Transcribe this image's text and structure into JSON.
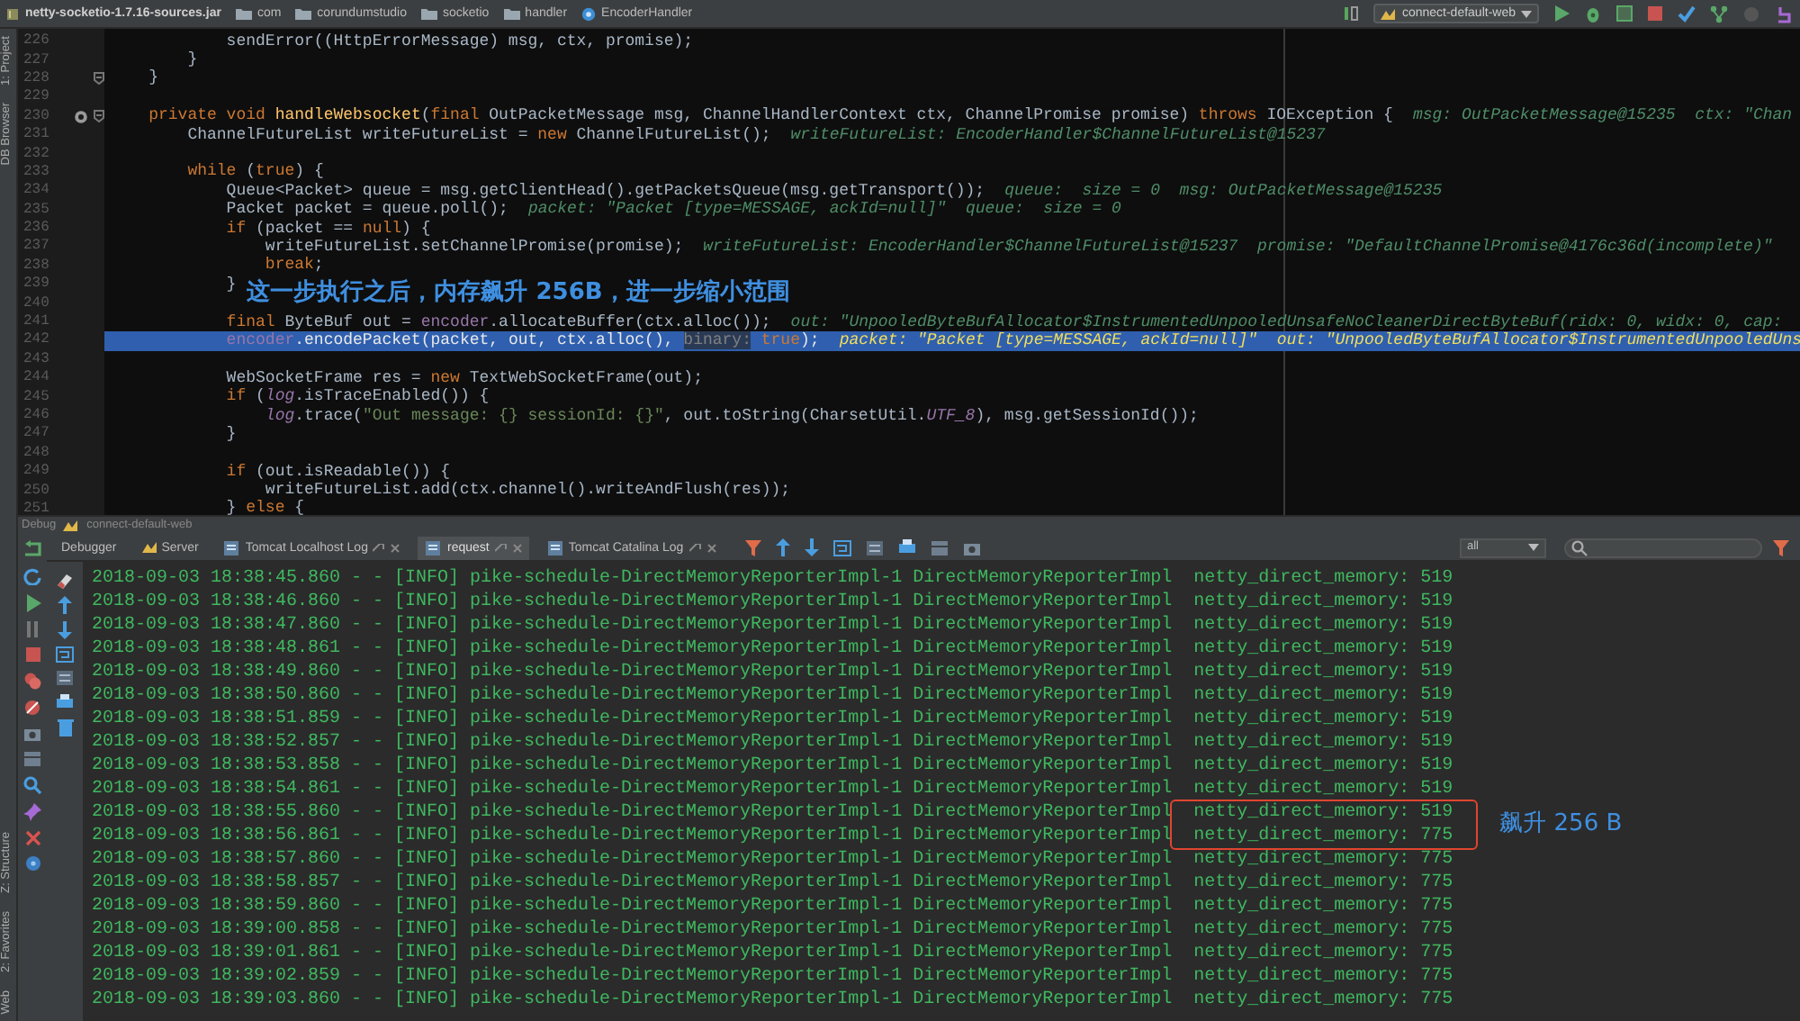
{
  "breadcrumbs": [
    {
      "label": "netty-socketio-1.7.16-sources.jar",
      "kind": "jar"
    },
    {
      "label": "com",
      "kind": "package"
    },
    {
      "label": "corundumstudio",
      "kind": "package"
    },
    {
      "label": "socketio",
      "kind": "package"
    },
    {
      "label": "handler",
      "kind": "package"
    },
    {
      "label": "EncoderHandler",
      "kind": "class"
    }
  ],
  "run_config": {
    "label": "connect-default-web"
  },
  "left_tool_windows": {
    "top": [
      {
        "label": "1: Project"
      },
      {
        "label": "DB Browser"
      }
    ],
    "bottom": [
      {
        "label": "Z: Structure"
      },
      {
        "label": "2: Favorites"
      },
      {
        "label": "Web"
      }
    ]
  },
  "editor": {
    "lines": [
      {
        "number": "226",
        "current": false,
        "override_marker": false,
        "fold_marker": false,
        "tokens": [
          {
            "kind": "plain",
            "text": "            sendError((HttpErrorMessage) msg, ctx, promise);"
          }
        ]
      },
      {
        "number": "227",
        "current": false,
        "override_marker": false,
        "fold_marker": false,
        "tokens": [
          {
            "kind": "plain",
            "text": "        }"
          }
        ]
      },
      {
        "number": "228",
        "current": false,
        "override_marker": false,
        "fold_marker": true,
        "tokens": [
          {
            "kind": "plain",
            "text": "    }"
          }
        ]
      },
      {
        "number": "229",
        "current": false,
        "override_marker": false,
        "fold_marker": false
      },
      {
        "number": "230",
        "current": false,
        "override_marker": true,
        "fold_marker": true,
        "tokens": [
          {
            "kind": "keyword",
            "text": "    private void "
          },
          {
            "kind": "method",
            "text": "handleWebsocket"
          },
          {
            "kind": "plain",
            "text": "("
          },
          {
            "kind": "keyword",
            "text": "final "
          },
          {
            "kind": "plain",
            "text": "OutPacketMessage msg, ChannelHandlerContext ctx, ChannelPromise promise) "
          },
          {
            "kind": "keyword",
            "text": "throws "
          },
          {
            "kind": "plain",
            "text": "IOException {"
          }
        ],
        "hint": "msg: OutPacketMessage@15235  ctx: \"Chan"
      },
      {
        "number": "231",
        "current": false,
        "override_marker": false,
        "fold_marker": false,
        "tokens": [
          {
            "kind": "plain",
            "text": "        ChannelFutureList writeFutureList = "
          },
          {
            "kind": "keyword",
            "text": "new "
          },
          {
            "kind": "plain",
            "text": "ChannelFutureList();"
          }
        ],
        "hint": "writeFutureList: EncoderHandler$ChannelFutureList@15237"
      },
      {
        "number": "232",
        "current": false,
        "override_marker": false,
        "fold_marker": false
      },
      {
        "number": "233",
        "current": false,
        "override_marker": false,
        "fold_marker": false,
        "tokens": [
          {
            "kind": "keyword",
            "text": "        while "
          },
          {
            "kind": "plain",
            "text": "("
          },
          {
            "kind": "keyword",
            "text": "true"
          },
          {
            "kind": "plain",
            "text": ") {"
          }
        ]
      },
      {
        "number": "234",
        "current": false,
        "override_marker": false,
        "fold_marker": false,
        "tokens": [
          {
            "kind": "plain",
            "text": "            Queue<Packet> queue = msg.getClientHead().getPacketsQueue(msg.getTransport());"
          }
        ],
        "hint": "queue:  size = 0  msg: OutPacketMessage@15235"
      },
      {
        "number": "235",
        "current": false,
        "override_marker": false,
        "fold_marker": false,
        "tokens": [
          {
            "kind": "plain",
            "text": "            Packet packet = queue.poll();"
          }
        ],
        "hint": "packet: \"Packet [type=MESSAGE, ackId=null]\"  queue:  size = 0"
      },
      {
        "number": "236",
        "current": false,
        "override_marker": false,
        "fold_marker": false,
        "tokens": [
          {
            "kind": "keyword",
            "text": "            if "
          },
          {
            "kind": "plain",
            "text": "(packet == "
          },
          {
            "kind": "keyword",
            "text": "null"
          },
          {
            "kind": "plain",
            "text": ") {"
          }
        ]
      },
      {
        "number": "237",
        "current": false,
        "override_marker": false,
        "fold_marker": false,
        "tokens": [
          {
            "kind": "plain",
            "text": "                writeFutureList.setChannelPromise(promise);"
          }
        ],
        "hint": "writeFutureList: EncoderHandler$ChannelFutureList@15237  promise: \"DefaultChannelPromise@4176c36d(incomplete)\""
      },
      {
        "number": "238",
        "current": false,
        "override_marker": false,
        "fold_marker": false,
        "tokens": [
          {
            "kind": "keyword",
            "text": "                break"
          },
          {
            "kind": "plain",
            "text": ";"
          }
        ]
      },
      {
        "number": "239",
        "current": false,
        "override_marker": false,
        "fold_marker": false,
        "tokens": [
          {
            "kind": "plain",
            "text": "            }"
          }
        ],
        "note": "这一步执行之后，内存飙升 256B，进一步缩小范围"
      },
      {
        "number": "240",
        "current": false,
        "override_marker": false,
        "fold_marker": false
      },
      {
        "number": "241",
        "current": false,
        "override_marker": false,
        "fold_marker": false,
        "tokens": [
          {
            "kind": "keyword",
            "text": "            final "
          },
          {
            "kind": "plain",
            "text": "ByteBuf out = "
          },
          {
            "kind": "field",
            "text": "encoder"
          },
          {
            "kind": "plain",
            "text": ".allocateBuffer(ctx.alloc());"
          }
        ],
        "hint": "out: \"UnpooledByteBufAllocator$InstrumentedUnpooledUnsafeNoCleanerDirectByteBuf(ridx: 0, widx: 0, cap:"
      },
      {
        "number": "242",
        "current": true,
        "override_marker": false,
        "fold_marker": false,
        "tokens": [
          {
            "kind": "field",
            "text": "            encoder"
          },
          {
            "kind": "plain",
            "text": ".encodePacket(packet, out, ctx.alloc(), "
          },
          {
            "kind": "param",
            "text": "binary:"
          },
          {
            "kind": "keyword",
            "text": " true"
          },
          {
            "kind": "plain",
            "text": ");"
          }
        ],
        "hint": "packet: \"Packet [type=MESSAGE, ackId=null]\"  out: \"UnpooledByteBufAllocator$InstrumentedUnpooledUns"
      },
      {
        "number": "243",
        "current": false,
        "override_marker": false,
        "fold_marker": false
      },
      {
        "number": "244",
        "current": false,
        "override_marker": false,
        "fold_marker": false,
        "tokens": [
          {
            "kind": "plain",
            "text": "            WebSocketFrame res = "
          },
          {
            "kind": "keyword",
            "text": "new "
          },
          {
            "kind": "plain",
            "text": "TextWebSocketFrame(out);"
          }
        ]
      },
      {
        "number": "245",
        "current": false,
        "override_marker": false,
        "fold_marker": false,
        "tokens": [
          {
            "kind": "keyword",
            "text": "            if "
          },
          {
            "kind": "plain",
            "text": "("
          },
          {
            "kind": "static",
            "text": "log"
          },
          {
            "kind": "plain",
            "text": ".isTraceEnabled()) {"
          }
        ]
      },
      {
        "number": "246",
        "current": false,
        "override_marker": false,
        "fold_marker": false,
        "tokens": [
          {
            "kind": "static",
            "text": "                log"
          },
          {
            "kind": "plain",
            "text": ".trace("
          },
          {
            "kind": "string",
            "text": "\"Out message: {} sessionId: {}\""
          },
          {
            "kind": "plain",
            "text": ", out.toString(CharsetUtil."
          },
          {
            "kind": "static",
            "text": "UTF_8"
          },
          {
            "kind": "plain",
            "text": "), msg.getSessionId());"
          }
        ]
      },
      {
        "number": "247",
        "current": false,
        "override_marker": false,
        "fold_marker": false,
        "tokens": [
          {
            "kind": "plain",
            "text": "            }"
          }
        ]
      },
      {
        "number": "248",
        "current": false,
        "override_marker": false,
        "fold_marker": false
      },
      {
        "number": "249",
        "current": false,
        "override_marker": false,
        "fold_marker": false,
        "tokens": [
          {
            "kind": "keyword",
            "text": "            if "
          },
          {
            "kind": "plain",
            "text": "(out.isReadable()) {"
          }
        ]
      },
      {
        "number": "250",
        "current": false,
        "override_marker": false,
        "fold_marker": false,
        "tokens": [
          {
            "kind": "plain",
            "text": "                writeFutureList.add(ctx.channel().writeAndFlush(res));"
          }
        ]
      },
      {
        "number": "251",
        "current": false,
        "override_marker": false,
        "fold_marker": false,
        "tokens": [
          {
            "kind": "plain",
            "text": "            } "
          },
          {
            "kind": "keyword",
            "text": "else "
          },
          {
            "kind": "plain",
            "text": "{"
          }
        ]
      }
    ]
  },
  "debug_panel": {
    "title": "Debug",
    "config": "connect-default-web",
    "tabs": [
      {
        "label": "Debugger",
        "selected": false,
        "closable": false
      },
      {
        "label": "Server",
        "selected": false,
        "closable": false
      },
      {
        "label": "Tomcat Localhost Log",
        "selected": false,
        "closable": true
      },
      {
        "label": "request",
        "selected": true,
        "closable": true
      },
      {
        "label": "Tomcat Catalina Log",
        "selected": false,
        "closable": true
      }
    ],
    "log_filter": {
      "value": "all"
    },
    "console": [
      {
        "source": "2018-09-03 18:38:45.860 - - [INFO] pike-schedule-DirectMemoryReporterImpl-1 DirectMemoryReporterImpl",
        "message": "netty_direct_memory: 519",
        "highlighted": false
      },
      {
        "source": "2018-09-03 18:38:46.860 - - [INFO] pike-schedule-DirectMemoryReporterImpl-1 DirectMemoryReporterImpl",
        "message": "netty_direct_memory: 519",
        "highlighted": false
      },
      {
        "source": "2018-09-03 18:38:47.860 - - [INFO] pike-schedule-DirectMemoryReporterImpl-1 DirectMemoryReporterImpl",
        "message": "netty_direct_memory: 519",
        "highlighted": false
      },
      {
        "source": "2018-09-03 18:38:48.861 - - [INFO] pike-schedule-DirectMemoryReporterImpl-1 DirectMemoryReporterImpl",
        "message": "netty_direct_memory: 519",
        "highlighted": false
      },
      {
        "source": "2018-09-03 18:38:49.860 - - [INFO] pike-schedule-DirectMemoryReporterImpl-1 DirectMemoryReporterImpl",
        "message": "netty_direct_memory: 519",
        "highlighted": false
      },
      {
        "source": "2018-09-03 18:38:50.860 - - [INFO] pike-schedule-DirectMemoryReporterImpl-1 DirectMemoryReporterImpl",
        "message": "netty_direct_memory: 519",
        "highlighted": false
      },
      {
        "source": "2018-09-03 18:38:51.859 - - [INFO] pike-schedule-DirectMemoryReporterImpl-1 DirectMemoryReporterImpl",
        "message": "netty_direct_memory: 519",
        "highlighted": false
      },
      {
        "source": "2018-09-03 18:38:52.857 - - [INFO] pike-schedule-DirectMemoryReporterImpl-1 DirectMemoryReporterImpl",
        "message": "netty_direct_memory: 519",
        "highlighted": false
      },
      {
        "source": "2018-09-03 18:38:53.858 - - [INFO] pike-schedule-DirectMemoryReporterImpl-1 DirectMemoryReporterImpl",
        "message": "netty_direct_memory: 519",
        "highlighted": false
      },
      {
        "source": "2018-09-03 18:38:54.861 - - [INFO] pike-schedule-DirectMemoryReporterImpl-1 DirectMemoryReporterImpl",
        "message": "netty_direct_memory: 519",
        "highlighted": false
      },
      {
        "source": "2018-09-03 18:38:55.860 - - [INFO] pike-schedule-DirectMemoryReporterImpl-1 DirectMemoryReporterImpl",
        "message": "netty_direct_memory: 519",
        "highlighted": true
      },
      {
        "source": "2018-09-03 18:38:56.861 - - [INFO] pike-schedule-DirectMemoryReporterImpl-1 DirectMemoryReporterImpl",
        "message": "netty_direct_memory: 775",
        "highlighted": true
      },
      {
        "source": "2018-09-03 18:38:57.860 - - [INFO] pike-schedule-DirectMemoryReporterImpl-1 DirectMemoryReporterImpl",
        "message": "netty_direct_memory: 775",
        "highlighted": false
      },
      {
        "source": "2018-09-03 18:38:58.857 - - [INFO] pike-schedule-DirectMemoryReporterImpl-1 DirectMemoryReporterImpl",
        "message": "netty_direct_memory: 775",
        "highlighted": false
      },
      {
        "source": "2018-09-03 18:38:59.860 - - [INFO] pike-schedule-DirectMemoryReporterImpl-1 DirectMemoryReporterImpl",
        "message": "netty_direct_memory: 775",
        "highlighted": false
      },
      {
        "source": "2018-09-03 18:39:00.858 - - [INFO] pike-schedule-DirectMemoryReporterImpl-1 DirectMemoryReporterImpl",
        "message": "netty_direct_memory: 775",
        "highlighted": false
      },
      {
        "source": "2018-09-03 18:39:01.861 - - [INFO] pike-schedule-DirectMemoryReporterImpl-1 DirectMemoryReporterImpl",
        "message": "netty_direct_memory: 775",
        "highlighted": false
      },
      {
        "source": "2018-09-03 18:39:02.859 - - [INFO] pike-schedule-DirectMemoryReporterImpl-1 DirectMemoryReporterImpl",
        "message": "netty_direct_memory: 775",
        "highlighted": false
      },
      {
        "source": "2018-09-03 18:39:03.860 - - [INFO] pike-schedule-DirectMemoryReporterImpl-1 DirectMemoryReporterImpl",
        "message": "netty_direct_memory: 775",
        "highlighted": false
      }
    ],
    "console_note": "飙升 256 B"
  }
}
